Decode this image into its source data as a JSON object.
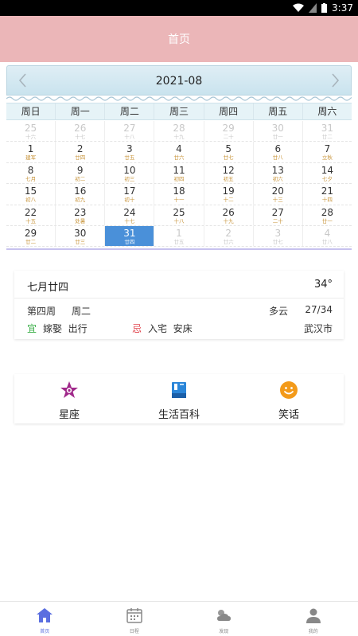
{
  "status_bar": {
    "time": "3:37"
  },
  "app_bar": {
    "title": "首页"
  },
  "calendar": {
    "month": "2021-08",
    "weekdays": [
      "周日",
      "周一",
      "周二",
      "周三",
      "周四",
      "周五",
      "周六"
    ],
    "weeks": [
      [
        {
          "day": "25",
          "lunar": "十六",
          "other": true
        },
        {
          "day": "26",
          "lunar": "十七",
          "other": true
        },
        {
          "day": "27",
          "lunar": "十八",
          "other": true
        },
        {
          "day": "28",
          "lunar": "十九",
          "other": true
        },
        {
          "day": "29",
          "lunar": "二十",
          "other": true
        },
        {
          "day": "30",
          "lunar": "廿一",
          "other": true
        },
        {
          "day": "31",
          "lunar": "廿二",
          "other": true
        }
      ],
      [
        {
          "day": "1",
          "lunar": "建军"
        },
        {
          "day": "2",
          "lunar": "廿四"
        },
        {
          "day": "3",
          "lunar": "廿五"
        },
        {
          "day": "4",
          "lunar": "廿六"
        },
        {
          "day": "5",
          "lunar": "廿七"
        },
        {
          "day": "6",
          "lunar": "廿八"
        },
        {
          "day": "7",
          "lunar": "立秋"
        }
      ],
      [
        {
          "day": "8",
          "lunar": "七月"
        },
        {
          "day": "9",
          "lunar": "初二"
        },
        {
          "day": "10",
          "lunar": "初三"
        },
        {
          "day": "11",
          "lunar": "初四"
        },
        {
          "day": "12",
          "lunar": "初五"
        },
        {
          "day": "13",
          "lunar": "初六"
        },
        {
          "day": "14",
          "lunar": "七夕"
        }
      ],
      [
        {
          "day": "15",
          "lunar": "初八"
        },
        {
          "day": "16",
          "lunar": "初九"
        },
        {
          "day": "17",
          "lunar": "初十"
        },
        {
          "day": "18",
          "lunar": "十一"
        },
        {
          "day": "19",
          "lunar": "十二"
        },
        {
          "day": "20",
          "lunar": "十三"
        },
        {
          "day": "21",
          "lunar": "十四"
        }
      ],
      [
        {
          "day": "22",
          "lunar": "十五"
        },
        {
          "day": "23",
          "lunar": "处暑"
        },
        {
          "day": "24",
          "lunar": "十七"
        },
        {
          "day": "25",
          "lunar": "十八"
        },
        {
          "day": "26",
          "lunar": "十九"
        },
        {
          "day": "27",
          "lunar": "二十"
        },
        {
          "day": "28",
          "lunar": "廿一"
        }
      ],
      [
        {
          "day": "29",
          "lunar": "廿二"
        },
        {
          "day": "30",
          "lunar": "廿三"
        },
        {
          "day": "31",
          "lunar": "廿四",
          "selected": true
        },
        {
          "day": "1",
          "lunar": "廿五",
          "other": true
        },
        {
          "day": "2",
          "lunar": "廿六",
          "other": true
        },
        {
          "day": "3",
          "lunar": "廿七",
          "other": true
        },
        {
          "day": "4",
          "lunar": "廿八",
          "other": true
        }
      ]
    ]
  },
  "info": {
    "lunar_date": "七月廿四",
    "temperature": "34°",
    "week_of_month": "第四周",
    "weekday": "周二",
    "weather": "多云",
    "temp_range": "27/34",
    "yi_label": "宜",
    "yi_items": "嫁娶  出行",
    "ji_label": "忌",
    "ji_items": "入宅  安床",
    "city": "武汉市"
  },
  "features": [
    {
      "label": "星座",
      "icon": "star-icon",
      "color": "#a0288a"
    },
    {
      "label": "生活百科",
      "icon": "book-icon",
      "color": "#2b86d9"
    },
    {
      "label": "笑话",
      "icon": "smiley-icon",
      "color": "#f39a1a"
    }
  ],
  "tabs": [
    {
      "label": "首页",
      "icon": "home-icon",
      "active": true
    },
    {
      "label": "日程",
      "icon": "calendar-icon"
    },
    {
      "label": "发现",
      "icon": "weather-icon"
    },
    {
      "label": "我的",
      "icon": "person-icon"
    }
  ],
  "colors": {
    "app_bar": "#ebb6b8",
    "selected_day": "#4a90d9",
    "lunar_text": "#c8943a",
    "active_tab": "#5a6ee0"
  }
}
